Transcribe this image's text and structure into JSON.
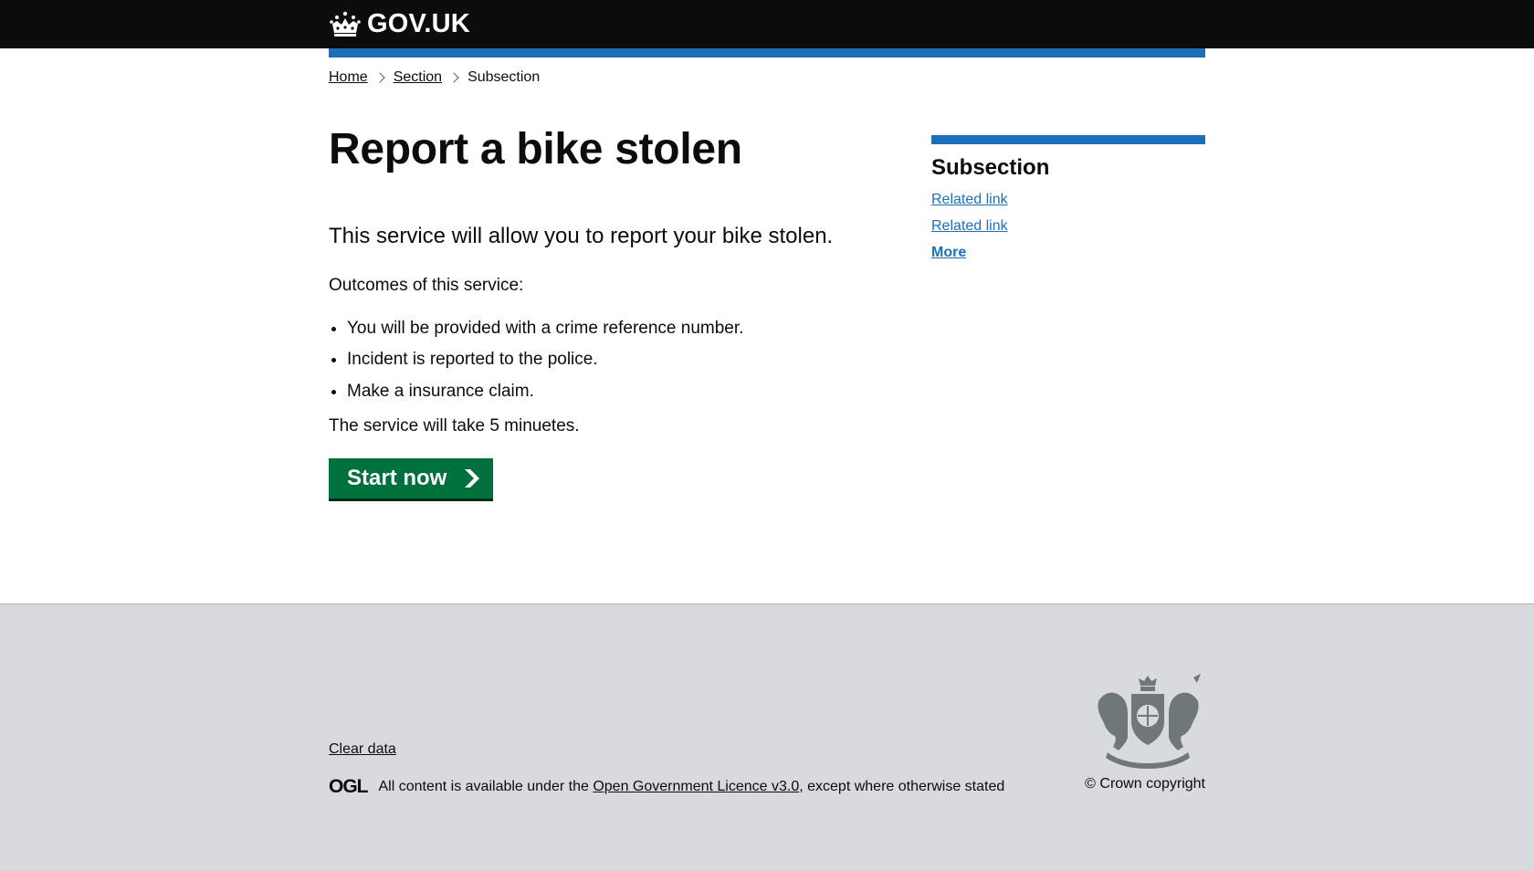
{
  "header": {
    "logo_text": "GOV.UK",
    "logo_icon": "crown-icon",
    "brand_bar_color": "#1d70b8"
  },
  "breadcrumb": {
    "items": [
      {
        "label": "Home"
      },
      {
        "label": "Section"
      }
    ],
    "current": "Subsection"
  },
  "main": {
    "title": "Report a bike stolen",
    "lead": "This service will allow you to report your bike stolen.",
    "outcomes_intro": "Outcomes of this service:",
    "outcomes": [
      "You will be provided with a crime reference number.",
      "Incident is reported to the police.",
      "Make a insurance claim."
    ],
    "duration": "The service will take 5 minuetes.",
    "start_button": "Start now",
    "start_button_color": "#00703c"
  },
  "aside": {
    "title": "Subsection",
    "links": [
      "Related link",
      "Related link"
    ],
    "more": "More"
  },
  "footer": {
    "clear_data": "Clear data",
    "ogl_logo": "OGL",
    "licence_prefix": "All content is available under the",
    "licence_link": "Open Government Licence v3.0",
    "licence_suffix": ", except where otherwise stated",
    "copyright": "© Crown copyright",
    "crest_icon": "royal-coat-of-arms-icon"
  }
}
